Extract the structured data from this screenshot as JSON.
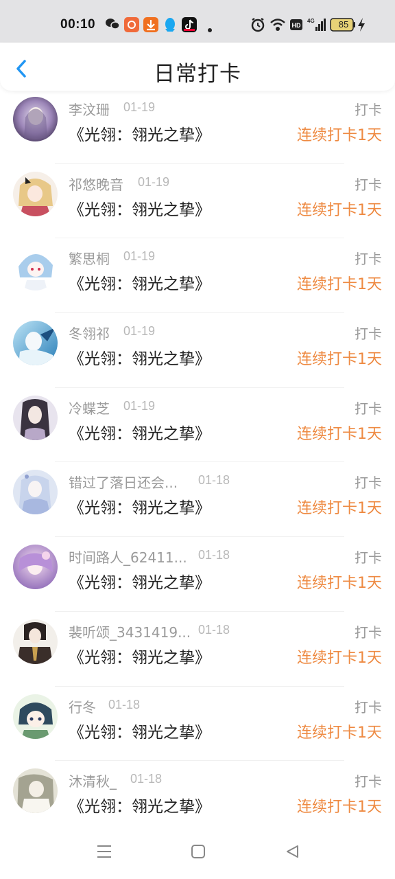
{
  "status_bar": {
    "time": "00:10",
    "icons": [
      "wechat-icon",
      "app-badge-icon",
      "download-icon",
      "qq-icon",
      "tiktok-icon",
      "dot-icon",
      "alarm-icon",
      "wifi-icon",
      "hd-icon",
      "signal-4g-icon",
      "battery-icon",
      "charging-icon"
    ],
    "battery": "85"
  },
  "header": {
    "title": "日常打卡",
    "back_icon": "chevron-left-icon"
  },
  "colors": {
    "accent": "#2196f3",
    "streak": "#ee8a42",
    "muted": "#9a9a9a"
  },
  "rows": [
    {
      "name": "李汶珊",
      "date": "01-19",
      "book": "《光翎：翎光之挚》",
      "action": "打卡",
      "streak": "连续打卡1天"
    },
    {
      "name": "祁悠晚音",
      "date": "01-19",
      "book": "《光翎：翎光之挚》",
      "action": "打卡",
      "streak": "连续打卡1天"
    },
    {
      "name": "繁思桐",
      "date": "01-19",
      "book": "《光翎：翎光之挚》",
      "action": "打卡",
      "streak": "连续打卡1天"
    },
    {
      "name": "冬翎祁",
      "date": "01-19",
      "book": "《光翎：翎光之挚》",
      "action": "打卡",
      "streak": "连续打卡1天"
    },
    {
      "name": "冷蝶芝",
      "date": "01-19",
      "book": "《光翎：翎光之挚》",
      "action": "打卡",
      "streak": "连续打卡1天"
    },
    {
      "name": "错过了落日还会...",
      "date": "01-18",
      "book": "《光翎：翎光之挚》",
      "action": "打卡",
      "streak": "连续打卡1天"
    },
    {
      "name": "时间路人_62411...",
      "date": "01-18",
      "book": "《光翎：翎光之挚》",
      "action": "打卡",
      "streak": "连续打卡1天"
    },
    {
      "name": "裴听颂_3431419...",
      "date": "01-18",
      "book": "《光翎：翎光之挚》",
      "action": "打卡",
      "streak": "连续打卡1天"
    },
    {
      "name": "行冬",
      "date": "01-18",
      "book": "《光翎：翎光之挚》",
      "action": "打卡",
      "streak": "连续打卡1天"
    },
    {
      "name": "沐清秋_",
      "date": "01-18",
      "book": "《光翎：翎光之挚》",
      "action": "打卡",
      "streak": "连续打卡1天"
    }
  ],
  "nav": {
    "icons": [
      "menu-icon",
      "home-square-icon",
      "back-triangle-icon"
    ]
  }
}
